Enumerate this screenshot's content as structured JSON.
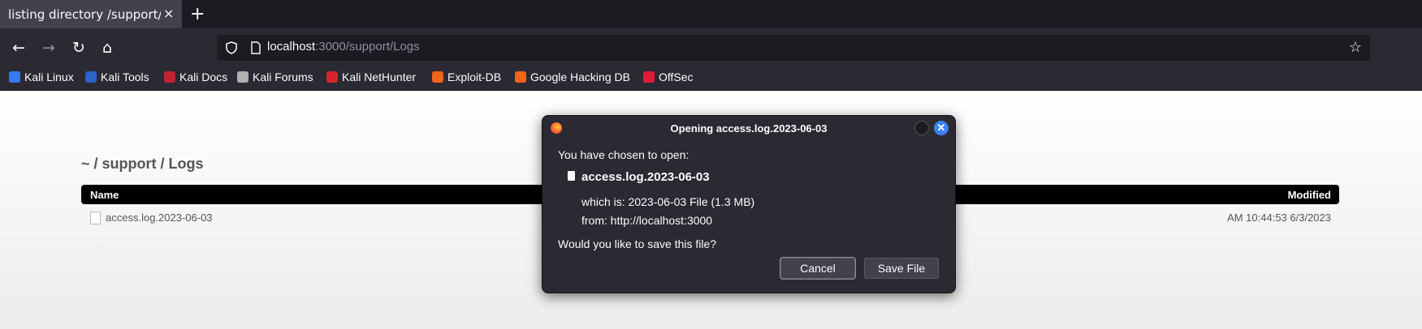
{
  "tab": {
    "title": "listing directory /support/Logs",
    "close": "×",
    "new_tab": "+"
  },
  "nav": {
    "back": "←",
    "forward": "→",
    "reload": "↻",
    "home": "⌂",
    "url_host": "localhost",
    "url_rest": ":3000/support/Logs",
    "star": "☆"
  },
  "bookmarks": [
    {
      "label": "Kali Linux",
      "icon": "kali-dragon-icon",
      "color": "#367bf0"
    },
    {
      "label": "Kali Tools",
      "icon": "kali-tools-icon",
      "color": "#2b63c9"
    },
    {
      "label": "Kali Docs",
      "icon": "kali-docs-icon",
      "color": "#c52233"
    },
    {
      "label": "Kali Forums",
      "icon": "kali-forums-icon",
      "color": "#b0b0b0"
    },
    {
      "label": "Kali NetHunter",
      "icon": "nethunter-icon",
      "color": "#d8242a"
    },
    {
      "label": "Exploit-DB",
      "icon": "exploitdb-icon",
      "color": "#f0631d"
    },
    {
      "label": "Google Hacking DB",
      "icon": "ghdb-icon",
      "color": "#f0631d"
    },
    {
      "label": "OffSec",
      "icon": "offsec-icon",
      "color": "#e31b3b"
    }
  ],
  "page": {
    "breadcrumb": "~ / support / Logs",
    "col_name": "Name",
    "col_modified": "Modified",
    "rows": [
      {
        "name": "access.log.2023-06-03",
        "modified": "AM 10:44:53 6/3/2023"
      }
    ]
  },
  "dialog": {
    "title": "Opening access.log.2023-06-03",
    "chosen": "You have chosen to open:",
    "file": "access.log.2023-06-03",
    "which": "which is:  2023-06-03 File (1.3 MB)",
    "from": "from:  http://localhost:3000",
    "question": "Would you like to save this file?",
    "cancel": "Cancel",
    "save": "Save File",
    "close": "✕"
  }
}
